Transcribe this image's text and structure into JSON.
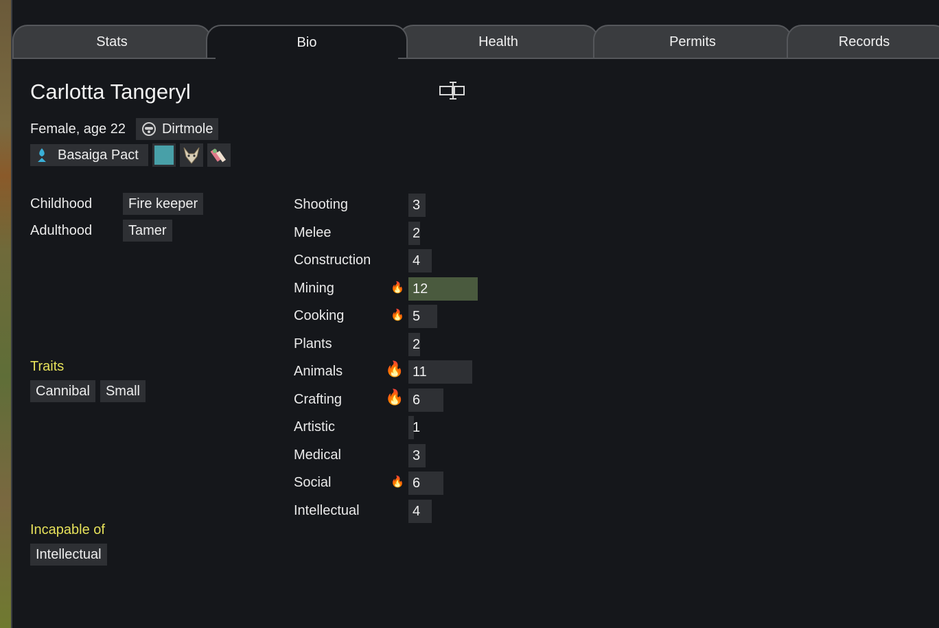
{
  "tabs": [
    "Stats",
    "Bio",
    "Health",
    "Permits",
    "Records"
  ],
  "active_tab": "Bio",
  "pawn": {
    "name": "Carlotta Tangeryl",
    "gender_age": "Female, age 22",
    "xenotype": "Dirtmole",
    "faction": "Basaiga Pact",
    "faction_color": "#48a0a8",
    "icons": [
      "ideo-color-swatch-icon",
      "fox-mask-icon",
      "tool-badge-icon"
    ]
  },
  "backstory": {
    "childhood_label": "Childhood",
    "childhood": "Fire keeper",
    "adulthood_label": "Adulthood",
    "adulthood": "Tamer"
  },
  "traits_title": "Traits",
  "traits": [
    "Cannibal",
    "Small"
  ],
  "incapable_title": "Incapable of",
  "incapable": [
    "Intellectual"
  ],
  "skills": [
    {
      "name": "Shooting",
      "level": "3",
      "passion": 0
    },
    {
      "name": "Melee",
      "level": "2",
      "passion": 0
    },
    {
      "name": "Construction",
      "level": "4",
      "passion": 0
    },
    {
      "name": "Mining",
      "level": "12",
      "passion": 1
    },
    {
      "name": "Cooking",
      "level": "5",
      "passion": 1
    },
    {
      "name": "Plants",
      "level": "2",
      "passion": 0
    },
    {
      "name": "Animals",
      "level": "11",
      "passion": 2
    },
    {
      "name": "Crafting",
      "level": "6",
      "passion": 2
    },
    {
      "name": "Artistic",
      "level": "1",
      "passion": 0
    },
    {
      "name": "Medical",
      "level": "3",
      "passion": 0
    },
    {
      "name": "Social",
      "level": "6",
      "passion": 1
    },
    {
      "name": "Intellectual",
      "level": "4",
      "passion": 0
    }
  ],
  "colors": {
    "accent_yellow": "#e6e15a",
    "highlight_bar": "#4a5a3e",
    "passion_flame": "#f5a623"
  }
}
